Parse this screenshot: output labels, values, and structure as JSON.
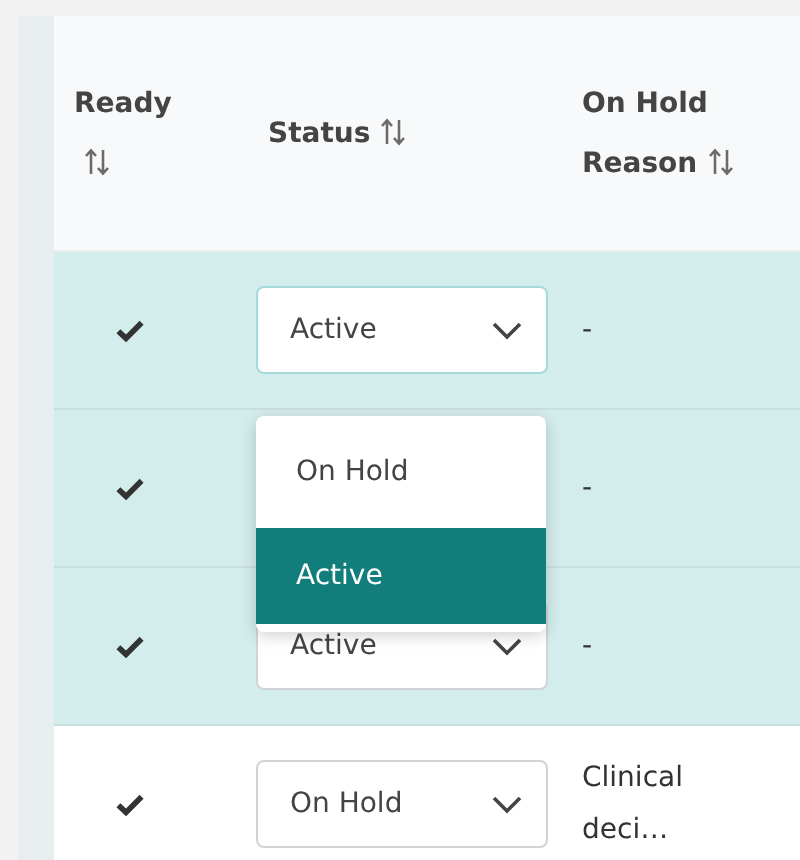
{
  "table": {
    "columns": [
      {
        "label": "Ready"
      },
      {
        "label": "Status"
      },
      {
        "label": "On Hold Reason"
      }
    ],
    "rows": [
      {
        "selected": true,
        "ready": true,
        "status": "Active",
        "reason": "-",
        "status_menu": [
          {
            "label": "On Hold",
            "selected": false
          },
          {
            "label": "Active",
            "selected": true
          }
        ]
      },
      {
        "selected": true,
        "ready": true,
        "reason": "-"
      },
      {
        "selected": true,
        "ready": true,
        "status": "Active",
        "reason": "-"
      },
      {
        "selected": false,
        "ready": true,
        "status": "On Hold",
        "reason": "Clinical deci…"
      }
    ]
  }
}
